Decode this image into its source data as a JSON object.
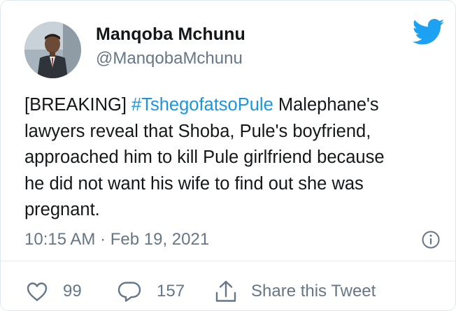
{
  "tweet": {
    "author": {
      "display_name": "Manqoba Mchunu",
      "handle": "@ManqobaMchunu"
    },
    "text": {
      "line1_prefix": "[BREAKING] ",
      "hashtag": "#TshegofatsoPule",
      "line1_suffix": " Malephane's",
      "line2": "lawyers reveal that Shoba, Pule's boyfriend,",
      "line3": "approached him to kill Pule girlfriend because",
      "line4": "he did not want his wife to find out she was",
      "line5": "pregnant."
    },
    "timestamp": "10:15 AM · Feb 19, 2021",
    "likes": "99",
    "replies": "157",
    "share_label": "Share this Tweet"
  },
  "colors": {
    "brand": "#1da1f2",
    "hashtag": "#1b95e0",
    "secondary_text": "#657786",
    "primary_text": "#14171a"
  },
  "icons": [
    "twitter-bird-icon",
    "info-icon",
    "heart-icon",
    "reply-icon",
    "share-icon"
  ]
}
